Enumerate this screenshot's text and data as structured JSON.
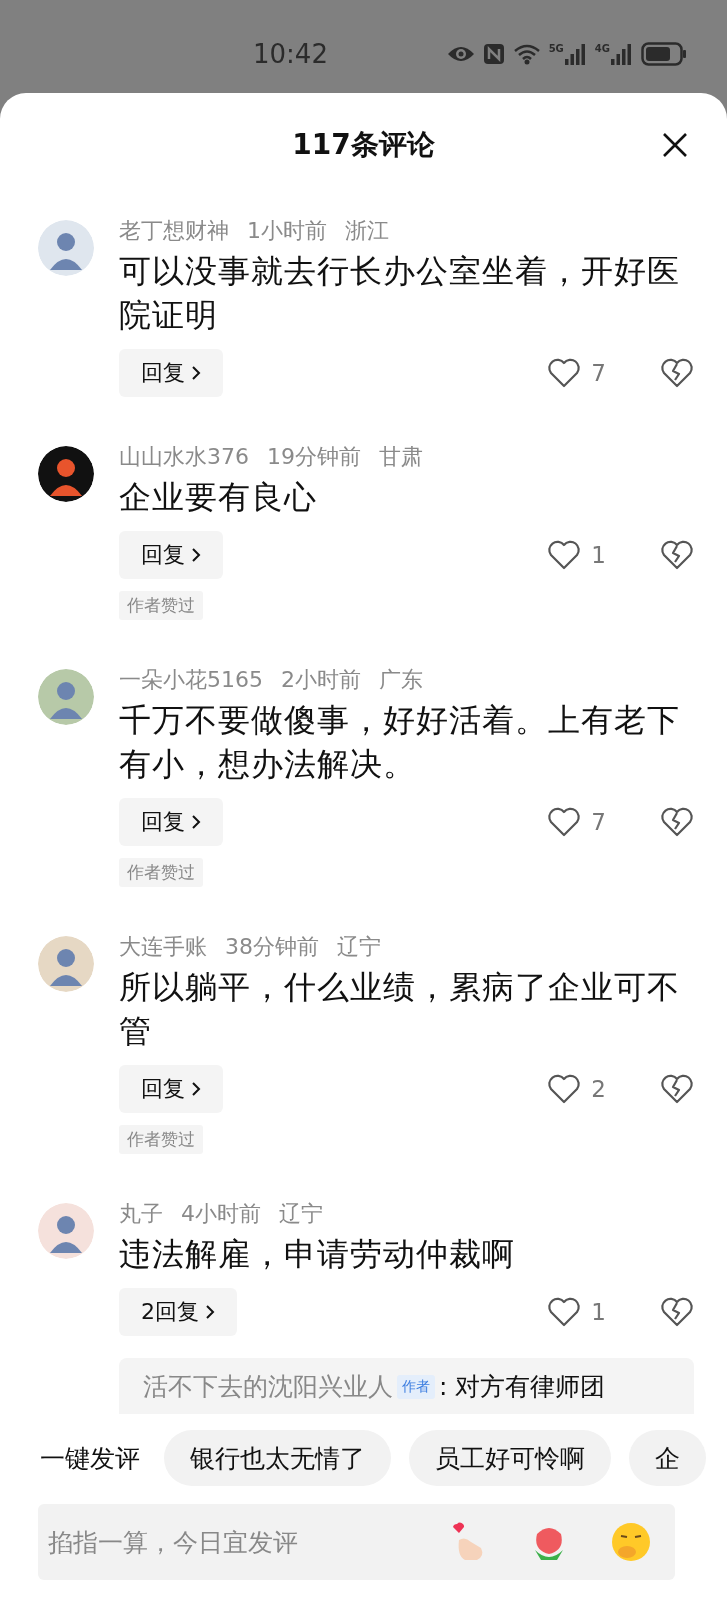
{
  "status_bar": {
    "time": "10:42",
    "signals": [
      "5G",
      "4G"
    ]
  },
  "title": "117条评论",
  "comments": [
    {
      "user": "老丁想财神",
      "time": "1小时前",
      "location": "浙江",
      "text": "可以没事就去行长办公室坐着，开好医院证明",
      "reply_button": "回复",
      "likes": "7"
    },
    {
      "user": "山山水水376",
      "time": "19分钟前",
      "location": "甘肃",
      "text": "企业要有良心",
      "reply_button": "回复",
      "likes": "1",
      "author_tag": "作者赞过"
    },
    {
      "user": "一朵小花5165",
      "time": "2小时前",
      "location": "广东",
      "text": "千万不要做傻事，好好活着。上有老下有小，想办法解决。",
      "reply_button": "回复",
      "likes": "7",
      "author_tag": "作者赞过"
    },
    {
      "user": "大连手账",
      "time": "38分钟前",
      "location": "辽宁",
      "text": "所以躺平，什么业绩，累病了企业可不管",
      "reply_button": "回复",
      "likes": "2",
      "author_tag": "作者赞过"
    },
    {
      "user": "丸子",
      "time": "4小时前",
      "location": "辽宁",
      "text": "违法解雇，申请劳动仲裁啊",
      "reply_button": "2回复",
      "likes": "1",
      "replies": [
        {
          "user": "活不下去的沈阳兴业人",
          "badge": "作者",
          "text": ": 对方有律师团"
        }
      ]
    }
  ],
  "quick_comments": {
    "label": "一键发评",
    "chips": [
      "银行也太无情了",
      "员工好可怜啊",
      "企"
    ]
  },
  "input": {
    "placeholder": "掐指一算，今日宜发评"
  }
}
